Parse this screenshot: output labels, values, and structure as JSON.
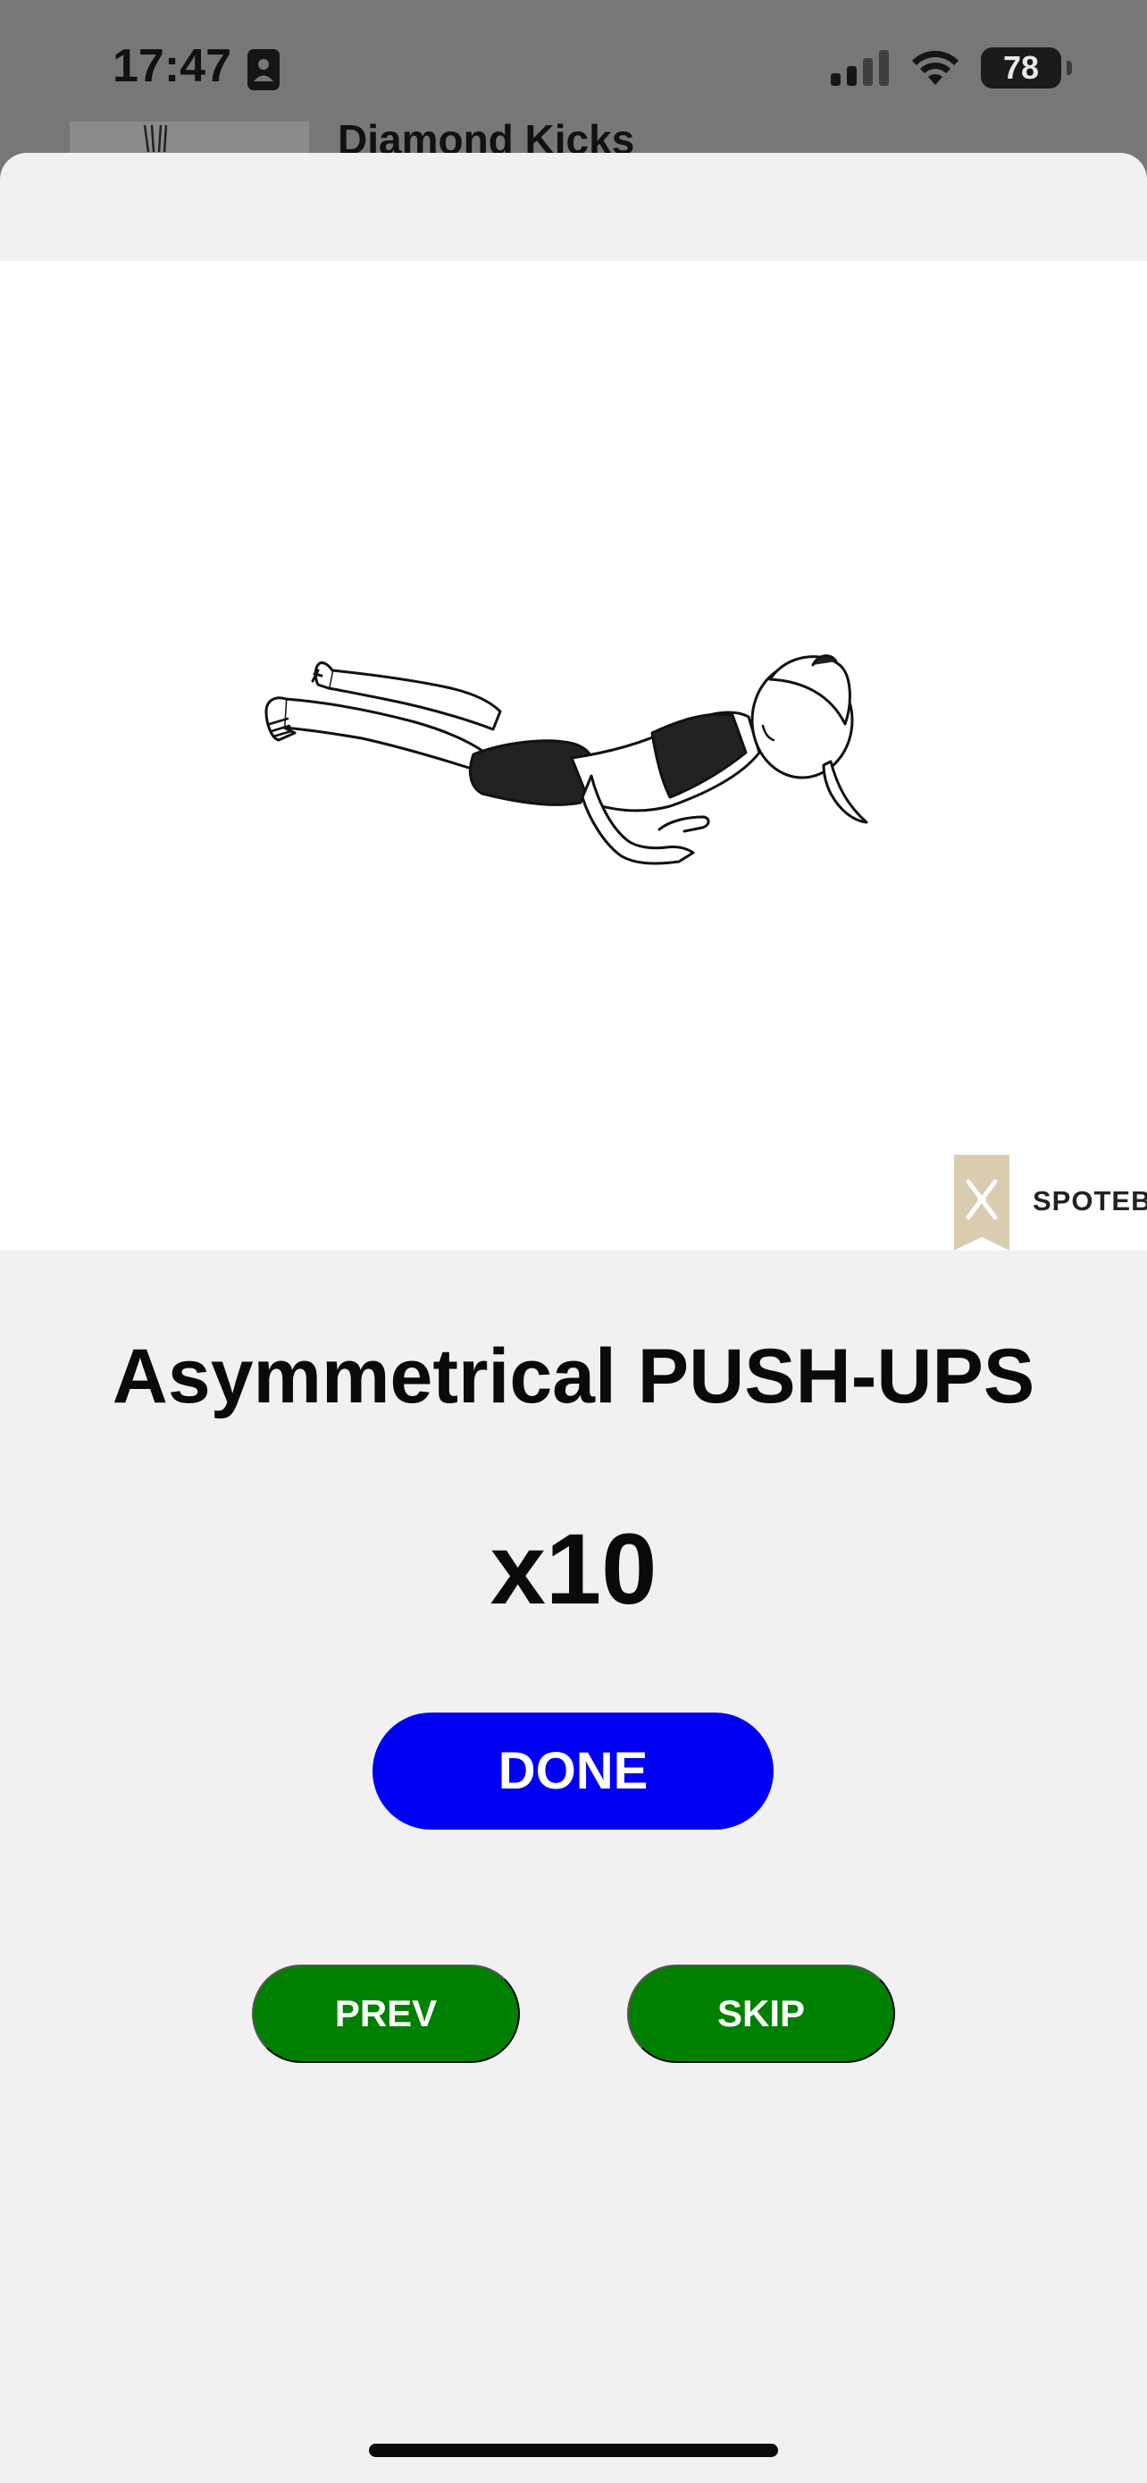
{
  "status_bar": {
    "time": "17:47",
    "battery": "78",
    "icons": [
      "person-badge-icon",
      "cellular-signal-icon",
      "wifi-icon",
      "battery-icon"
    ]
  },
  "background": {
    "list_item_title": "Diamond Kicks"
  },
  "exercise": {
    "title": "Asymmetrical PUSH-UPS",
    "reps": "x10",
    "watermark": "SPOTEB"
  },
  "actions": {
    "done_label": "DONE",
    "prev_label": "PREV",
    "skip_label": "SKIP"
  },
  "colors": {
    "done": "#0000f5",
    "nav": "#008000",
    "sheet": "#f1f1f1",
    "media": "#ffffff"
  }
}
